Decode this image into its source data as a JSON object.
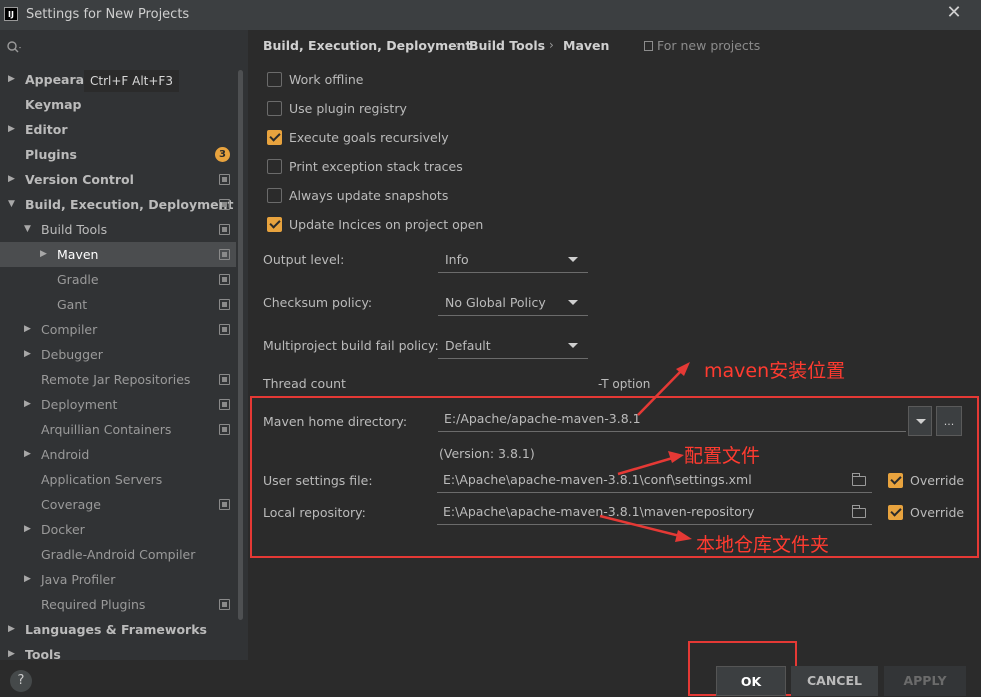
{
  "window": {
    "title": "Settings for New Projects",
    "app_icon_text": "IJ"
  },
  "sidebar": {
    "shortcut_tip": "Ctrl+F Alt+F3",
    "items": [
      {
        "label": "Appearance",
        "arrow": "▶"
      },
      {
        "label": "Keymap",
        "arrow": ""
      },
      {
        "label": "Editor",
        "arrow": "▶"
      },
      {
        "label": "Plugins",
        "arrow": "",
        "badge": "3"
      },
      {
        "label": "Version Control",
        "arrow": "▶"
      },
      {
        "label": "Build, Execution, Deployment",
        "arrow": "▼"
      },
      {
        "label": "Build Tools",
        "arrow": "▼"
      },
      {
        "label": "Maven",
        "arrow": "▶"
      },
      {
        "label": "Gradle",
        "arrow": ""
      },
      {
        "label": "Gant",
        "arrow": ""
      },
      {
        "label": "Compiler",
        "arrow": "▶"
      },
      {
        "label": "Debugger",
        "arrow": "▶"
      },
      {
        "label": "Remote Jar Repositories",
        "arrow": ""
      },
      {
        "label": "Deployment",
        "arrow": "▶"
      },
      {
        "label": "Arquillian Containers",
        "arrow": ""
      },
      {
        "label": "Android",
        "arrow": "▶"
      },
      {
        "label": "Application Servers",
        "arrow": ""
      },
      {
        "label": "Coverage",
        "arrow": ""
      },
      {
        "label": "Docker",
        "arrow": "▶"
      },
      {
        "label": "Gradle-Android Compiler",
        "arrow": ""
      },
      {
        "label": "Java Profiler",
        "arrow": "▶"
      },
      {
        "label": "Required Plugins",
        "arrow": ""
      },
      {
        "label": "Languages & Frameworks",
        "arrow": "▶"
      },
      {
        "label": "Tools",
        "arrow": "▶"
      }
    ],
    "help": "?"
  },
  "breadcrumb": {
    "items": [
      "Build, Execution, Deployment",
      "Build Tools",
      "Maven"
    ],
    "separator": "›",
    "scope": "For new projects"
  },
  "checkboxes": [
    {
      "label": "Work offline",
      "checked": false
    },
    {
      "label": "Use plugin registry",
      "checked": false
    },
    {
      "label": "Execute goals recursively",
      "checked": true
    },
    {
      "label": "Print exception stack traces",
      "checked": false
    },
    {
      "label": "Always update snapshots",
      "checked": false
    },
    {
      "label": "Update Incices on project open",
      "checked": true
    }
  ],
  "form": {
    "output_level": {
      "label": "Output level:",
      "value": "Info"
    },
    "checksum_policy": {
      "label": "Checksum policy:",
      "value": "No Global Policy"
    },
    "multiproject": {
      "label": "Multiproject build fail policy:",
      "value": "Default"
    },
    "thread_count": {
      "label": "Thread count",
      "hint": "-T option"
    },
    "maven_home": {
      "label": "Maven home directory:",
      "value": "E:/Apache/apache-maven-3.8.1",
      "browse": "..."
    },
    "version": "(Version: 3.8.1)",
    "user_settings": {
      "label": "User settings file:",
      "value": "E:\\Apache\\apache-maven-3.8.1\\conf\\settings.xml",
      "override_label": "Override",
      "override": true
    },
    "local_repo": {
      "label": "Local repository:",
      "value": "E:\\Apache\\apache-maven-3.8.1\\maven-repository",
      "override_label": "Override",
      "override": true
    }
  },
  "annotations": {
    "maven_install": "maven安装位置",
    "config_file": "配置文件",
    "local_repo": "本地仓库文件夹",
    "color": "#e53935"
  },
  "footer": {
    "ok": "OK",
    "cancel": "CANCEL",
    "apply": "APPLY"
  }
}
